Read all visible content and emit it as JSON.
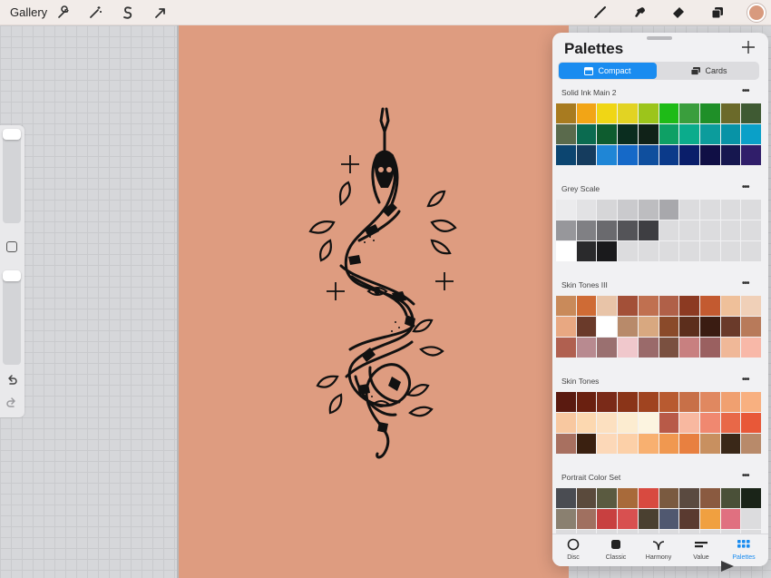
{
  "topbar": {
    "gallery_label": "Gallery",
    "left_tools": [
      "wrench-icon",
      "magic-wand-icon",
      "selection-s-icon",
      "transform-arrow-icon"
    ],
    "right_tools": [
      "brush-icon",
      "smudge-icon",
      "eraser-icon",
      "layers-icon"
    ],
    "current_color": "#d89a7e"
  },
  "canvas": {
    "artboard_color": "#de9c80",
    "background_color": "#d6d7da"
  },
  "sidebar": {
    "brush_size": 0.0,
    "opacity": 0.0
  },
  "panel": {
    "title": "Palettes",
    "segments": [
      {
        "label": "Compact",
        "active": true
      },
      {
        "label": "Cards",
        "active": false
      }
    ],
    "palettes": [
      {
        "name": "Solid Ink Main 2",
        "colors": [
          "#a87b20",
          "#f2a516",
          "#f0d615",
          "#e2d323",
          "#9cc51b",
          "#1ebb17",
          "#3a9e3d",
          "#1f8f28",
          "#6b6a2a",
          "#3f5a33",
          "#5a6a4c",
          "#0b6b50",
          "#0e5c2f",
          "#0a2d1f",
          "#102218",
          "#0ea065",
          "#0bac8c",
          "#0c9c9c",
          "#0893a6",
          "#0aa0c8",
          "#0c4570",
          "#153c5e",
          "#1f86d6",
          "#1569c8",
          "#0f4f9e",
          "#0b3a8a",
          "#0a1e6a",
          "#100f45",
          "#16174f",
          "#301e6a"
        ]
      },
      {
        "name": "Grey Scale",
        "colors": [
          "#ebebed",
          "#e2e2e4",
          "#d6d6d8",
          "#cacacd",
          "#bdbdc0",
          "#a8a8ac",
          "#dcdcde",
          "#dcdcde",
          "#dcdcde",
          "#dcdcde",
          "#97979b",
          "#808084",
          "#6a6a6e",
          "#545458",
          "#3e3e42",
          "#dcdcde",
          "#dcdcde",
          "#dcdcde",
          "#dcdcde",
          "#dcdcde",
          "#ffffff",
          "#2a2a2c",
          "#1a1a1c",
          "#dcdcde",
          "#dcdcde",
          "#dcdcde",
          "#dcdcde",
          "#dcdcde",
          "#dcdcde",
          "#dcdcde"
        ]
      },
      {
        "name": "Skin Tones III",
        "colors": [
          "#c98a5a",
          "#cf6b35",
          "#e8c4a8",
          "#a35038",
          "#c07050",
          "#b06048",
          "#8c3a22",
          "#c35a30",
          "#efc09a",
          "#f0d0b8",
          "#e8a882",
          "#6a3a2a",
          "#ffffff",
          "#b88a6a",
          "#d8a880",
          "#8a4a2a",
          "#5c2e1c",
          "#3a1c12",
          "#6a3a2a",
          "#b87a5a",
          "#b06050",
          "#b88a90",
          "#9a7070",
          "#f0c8cc",
          "#9a6a6a",
          "#7a5040",
          "#c88080",
          "#9a6060",
          "#f0b898",
          "#f8b8a8"
        ]
      },
      {
        "name": "Skin Tones",
        "colors": [
          "#5a1a10",
          "#6a2010",
          "#7a2a18",
          "#8a3418",
          "#a04420",
          "#b85a30",
          "#c87048",
          "#e08860",
          "#f0a070",
          "#f8b080",
          "#f8c8a0",
          "#fcd8b0",
          "#fce0c0",
          "#fcecd0",
          "#fcf4e0",
          "#b85a48",
          "#f8b8a0",
          "#f08870",
          "#e86848",
          "#e85838",
          "#a87060",
          "#3a2010",
          "#fcd8b8",
          "#fcd0a8",
          "#f8b070",
          "#f09850",
          "#e88040",
          "#c89060",
          "#3a2818",
          "#b88a6a"
        ]
      },
      {
        "name": "Portrait Color Set",
        "colors": [
          "#4a4c52",
          "#5a4a3c",
          "#5a5a40",
          "#a86a3a",
          "#d84a40",
          "#7a5a40",
          "#5a4a40",
          "#8a5a40",
          "#4a5038",
          "#1a2418",
          "#8a8070",
          "#a07060",
          "#c84040",
          "#d85050",
          "#4a4030",
          "#505870",
          "#5a3a30",
          "#f0a040",
          "#e07080",
          "#dcdcde",
          "#dcdcde",
          "#dcdcde",
          "#dcdcde",
          "#dcdcde",
          "#dcdcde",
          "#dcdcde",
          "#dcdcde",
          "#dcdcde",
          "#dcdcde",
          "#dcdcde"
        ]
      }
    ],
    "tabs": [
      {
        "label": "Disc",
        "icon": "disc-icon",
        "active": false
      },
      {
        "label": "Classic",
        "icon": "classic-square-icon",
        "active": false
      },
      {
        "label": "Harmony",
        "icon": "harmony-icon",
        "active": false
      },
      {
        "label": "Value",
        "icon": "value-sliders-icon",
        "active": false
      },
      {
        "label": "Palettes",
        "icon": "palettes-grid-icon",
        "active": true
      }
    ]
  }
}
